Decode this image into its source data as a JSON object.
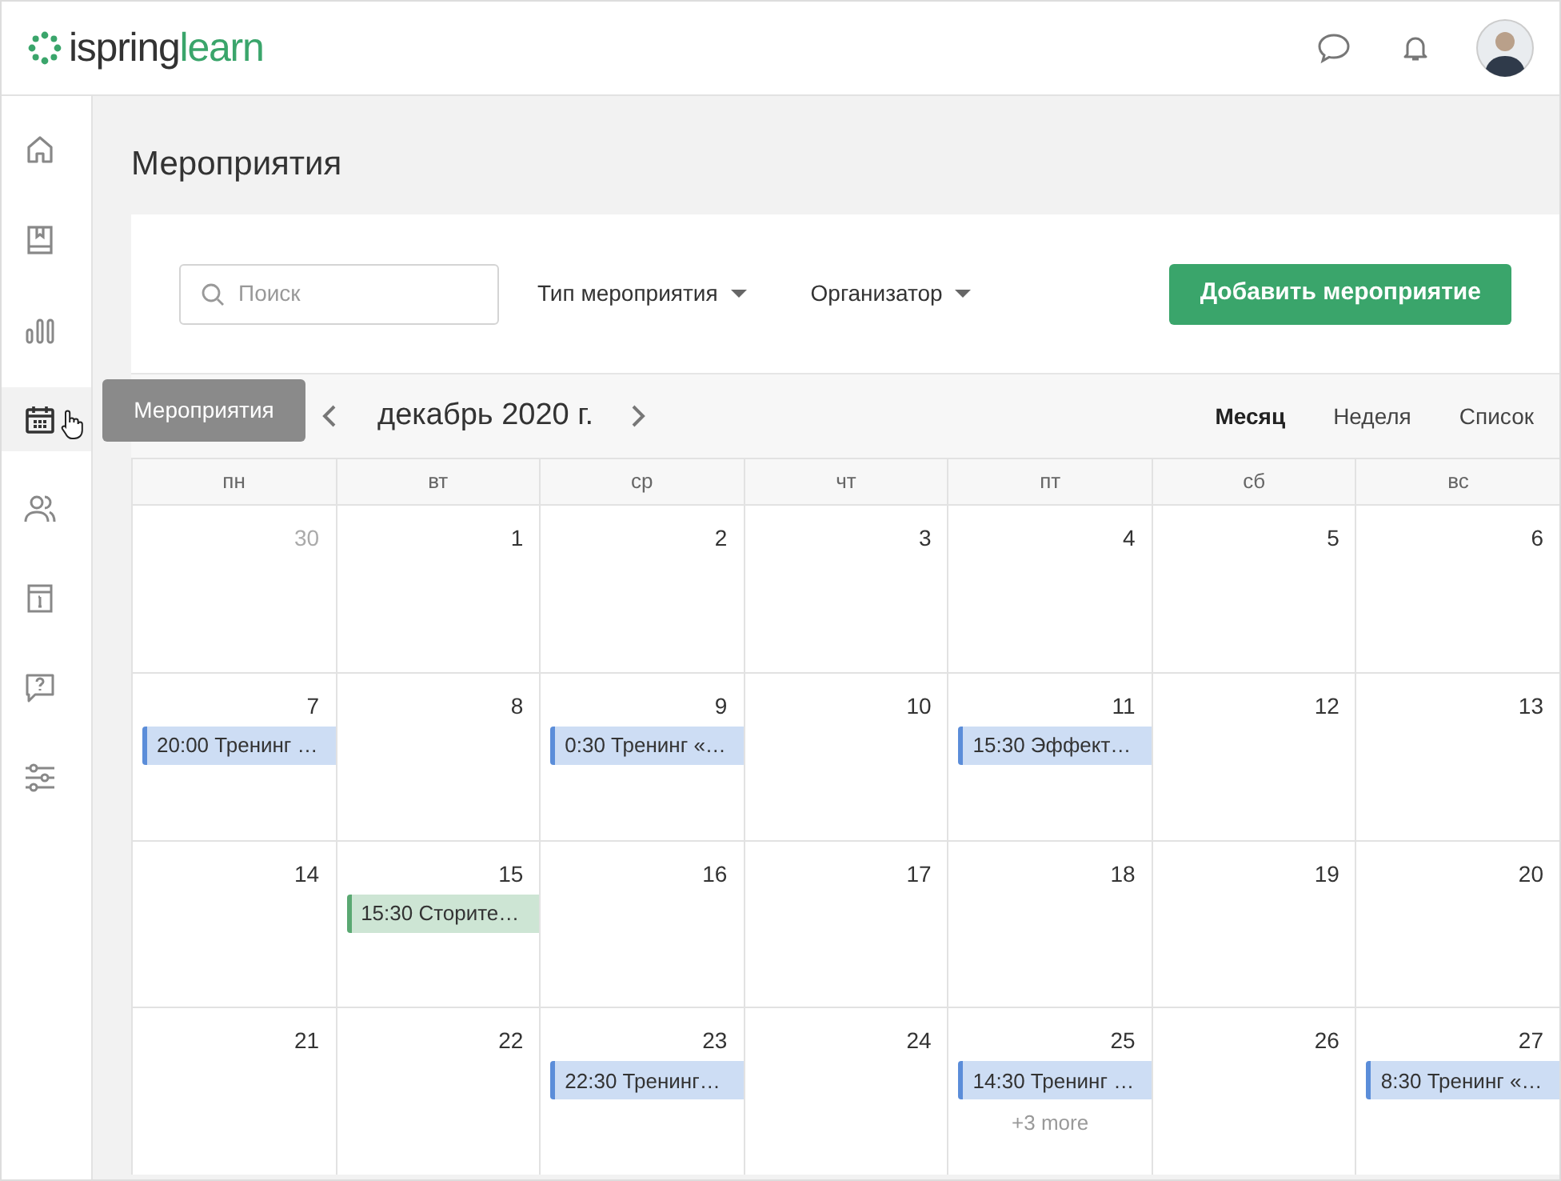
{
  "logo": {
    "brand": "ispring",
    "product": "learn"
  },
  "sidebar": {
    "items": [
      {
        "kind": "home",
        "selected": false
      },
      {
        "kind": "book",
        "selected": false
      },
      {
        "kind": "chart",
        "selected": false
      },
      {
        "kind": "calendar",
        "selected": true
      },
      {
        "kind": "people",
        "selected": false
      },
      {
        "kind": "info",
        "selected": false
      },
      {
        "kind": "help",
        "selected": false
      },
      {
        "kind": "settings",
        "selected": false
      }
    ]
  },
  "tooltip": "Мероприятия",
  "page_title": "Мероприятия",
  "toolbar": {
    "search": {
      "placeholder": "Поиск"
    },
    "filters": [
      "Тип мероприятия",
      "Организатор"
    ],
    "add_button": "Добавить мероприятие"
  },
  "calendar": {
    "period": "декабрь 2020 г.",
    "views": [
      {
        "label": "Месяц",
        "selected": true
      },
      {
        "label": "Неделя",
        "selected": false
      },
      {
        "label": "Список",
        "selected": false
      }
    ],
    "weekdays": [
      "пн",
      "вт",
      "ср",
      "чт",
      "пт",
      "сб",
      "вс"
    ],
    "weeks": [
      [
        {
          "day": "30",
          "muted": true
        },
        {
          "day": "1",
          "muted": false
        },
        {
          "day": "2",
          "muted": false
        },
        {
          "day": "3",
          "muted": false
        },
        {
          "day": "4",
          "muted": false
        },
        {
          "day": "5",
          "muted": false
        },
        {
          "day": "6",
          "muted": false
        }
      ],
      [
        {
          "day": "7",
          "muted": false,
          "events": [
            {
              "text": "20:00 Тренинг …",
              "color": "#5b8dd9"
            }
          ]
        },
        {
          "day": "8",
          "muted": false
        },
        {
          "day": "9",
          "muted": false,
          "events": [
            {
              "text": "0:30 Тренинг «…",
              "color": "#5b8dd9"
            }
          ]
        },
        {
          "day": "10",
          "muted": false
        },
        {
          "day": "11",
          "muted": false,
          "events": [
            {
              "text": "15:30 Эффект…",
              "color": "#5b8dd9"
            }
          ]
        },
        {
          "day": "12",
          "muted": false
        },
        {
          "day": "13",
          "muted": false
        }
      ],
      [
        {
          "day": "14",
          "muted": false
        },
        {
          "day": "15",
          "muted": false,
          "events": [
            {
              "text": "15:30 Сторите…",
              "color": "#5aa872"
            }
          ]
        },
        {
          "day": "16",
          "muted": false
        },
        {
          "day": "17",
          "muted": false
        },
        {
          "day": "18",
          "muted": false
        },
        {
          "day": "19",
          "muted": false
        },
        {
          "day": "20",
          "muted": false
        }
      ],
      [
        {
          "day": "21",
          "muted": false
        },
        {
          "day": "22",
          "muted": false
        },
        {
          "day": "23",
          "muted": false,
          "events": [
            {
              "text": "22:30 Тренинг…",
              "color": "#5b8dd9"
            }
          ]
        },
        {
          "day": "24",
          "muted": false
        },
        {
          "day": "25",
          "muted": false,
          "events": [
            {
              "text": "14:30 Тренинг …",
              "color": "#5b8dd9"
            }
          ],
          "more": "+3 more"
        },
        {
          "day": "26",
          "muted": false
        },
        {
          "day": "27",
          "muted": false,
          "events": [
            {
              "text": "8:30 Тренинг «…",
              "color": "#5b8dd9"
            }
          ]
        }
      ]
    ]
  }
}
